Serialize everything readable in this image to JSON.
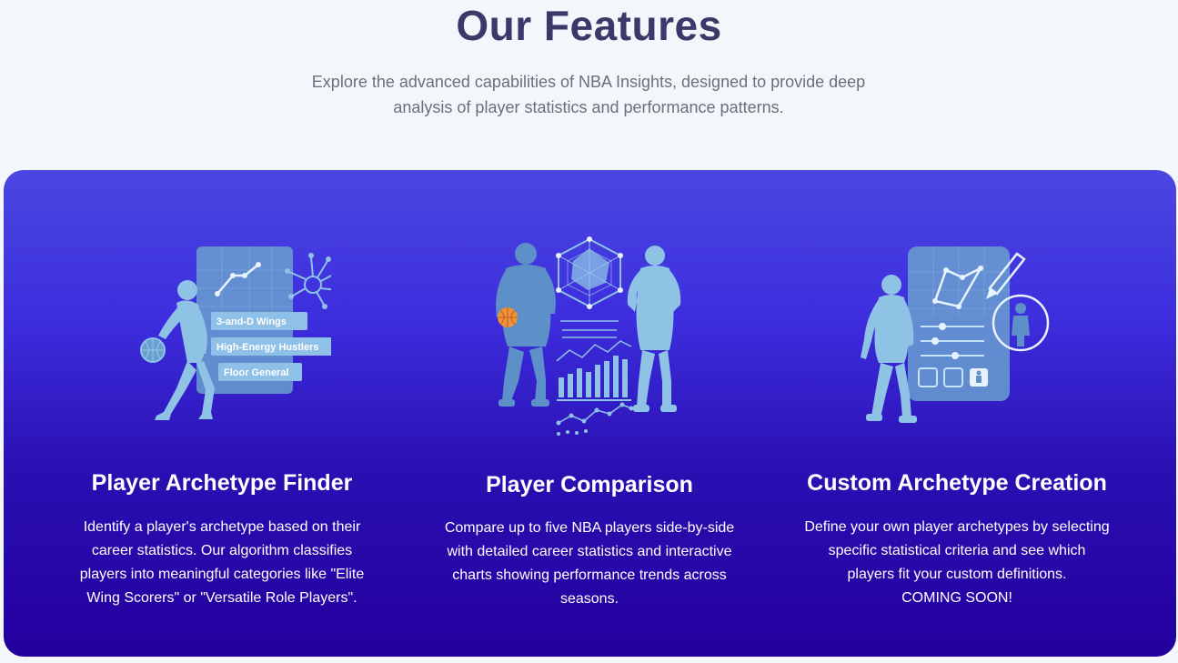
{
  "section": {
    "title": "Our Features",
    "subtitle_lines": [
      "Explore the advanced capabilities of NBA Insights, designed to provide deep",
      "analysis of player statistics and performance patterns."
    ]
  },
  "colors": {
    "title": "#3a3a6a",
    "panel_top": "#4a47e0",
    "panel_bottom": "#24009e",
    "illustration": "#8ec3e6",
    "basketball": "#f0923a"
  },
  "features": [
    {
      "title": "Player Archetype Finder",
      "illustration_icon": "player-archetype-illustration",
      "archetype_tags": [
        "3-and-D Wings",
        "High-Energy Hustlers",
        "Floor General"
      ],
      "description_lines": [
        "Identify a player's archetype based on their",
        "career statistics. Our algorithm classifies",
        "players into meaningful categories like \"Elite",
        "Wing Scorers\" or \"Versatile Role Players\"."
      ]
    },
    {
      "title": "Player Comparison",
      "illustration_icon": "player-comparison-illustration",
      "description_lines": [
        "Compare up to five NBA players side-by-side",
        "with detailed career statistics and interactive",
        "charts showing performance trends across",
        "seasons."
      ]
    },
    {
      "title": "Custom Archetype Creation",
      "illustration_icon": "custom-archetype-illustration",
      "description_lines": [
        "Define your own player archetypes by selecting",
        "specific statistical criteria and see which",
        "players fit your custom definitions.",
        "COMING SOON!"
      ]
    }
  ]
}
